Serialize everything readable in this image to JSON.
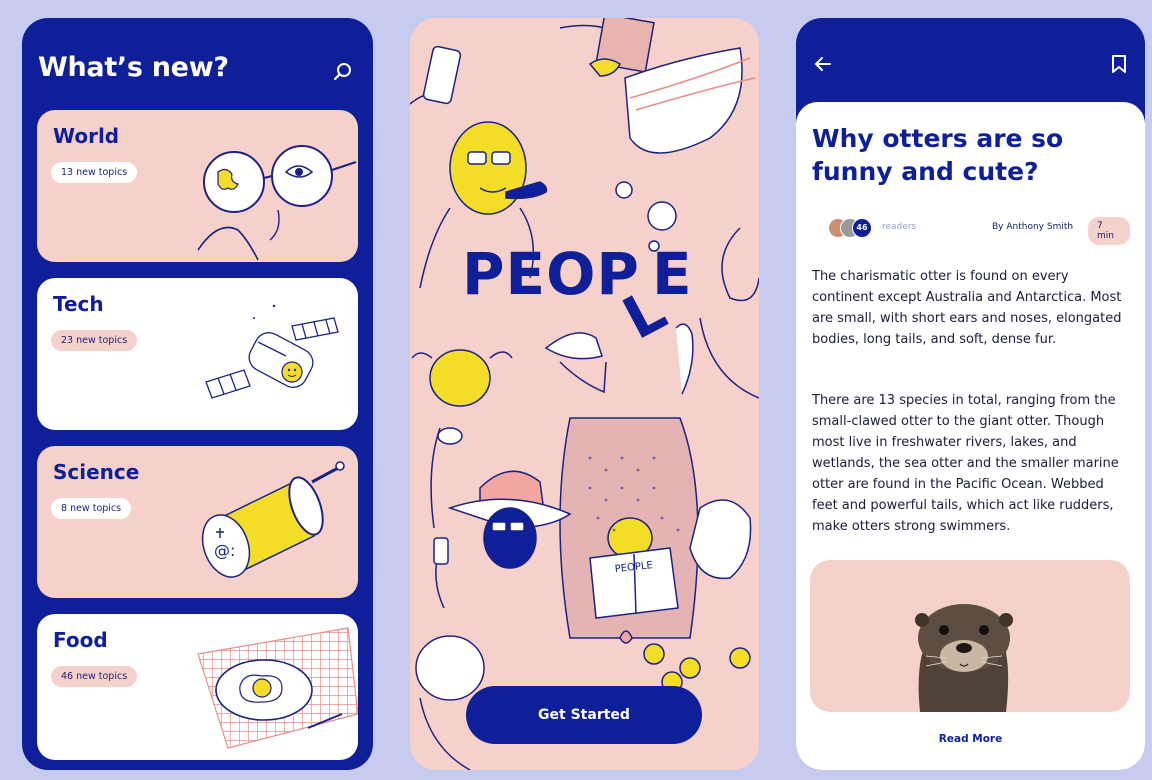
{
  "colors": {
    "navy": "#0f1f9a",
    "pink": "#f6d0cb",
    "yellow": "#f3dd26",
    "background": "#c7cbef"
  },
  "screen_news": {
    "title": "What’s new?",
    "search_icon": "search-icon",
    "categories": [
      {
        "name": "World",
        "topics": "13 new topics",
        "art": "globe-glasses"
      },
      {
        "name": "Tech",
        "topics": "23 new topics",
        "art": "satellite"
      },
      {
        "name": "Science",
        "topics": "8 new topics",
        "art": "microscope"
      },
      {
        "name": "Food",
        "topics": "46 new topics",
        "art": "fried-egg"
      }
    ]
  },
  "screen_intro": {
    "logo_word": "PEOP",
    "logo_tilted_letter": "L",
    "logo_last_letter": "E",
    "book_text": "PEOPLE",
    "button_label": "Get Started"
  },
  "screen_article": {
    "back_icon": "arrow-left-icon",
    "bookmark_icon": "bookmark-icon",
    "headline": "Why otters are so funny and cute?",
    "readers_count": "46",
    "readers_label": "readers",
    "author": "By Anthony Smith",
    "read_time": "7 min",
    "paragraphs": [
      "The charismatic otter is found on every continent except Australia and Antarctica. Most are small, with short ears and noses, elongated bodies, long tails, and soft, dense fur.",
      "There are 13 species in total, ranging from the small-clawed otter to the giant otter. Though most live in freshwater rivers, lakes, and wetlands, the sea otter and the smaller marine otter are found in the Pacific Ocean. Webbed feet and powerful tails, which act like rudders, make otters strong swimmers."
    ],
    "read_more": "Read More"
  }
}
